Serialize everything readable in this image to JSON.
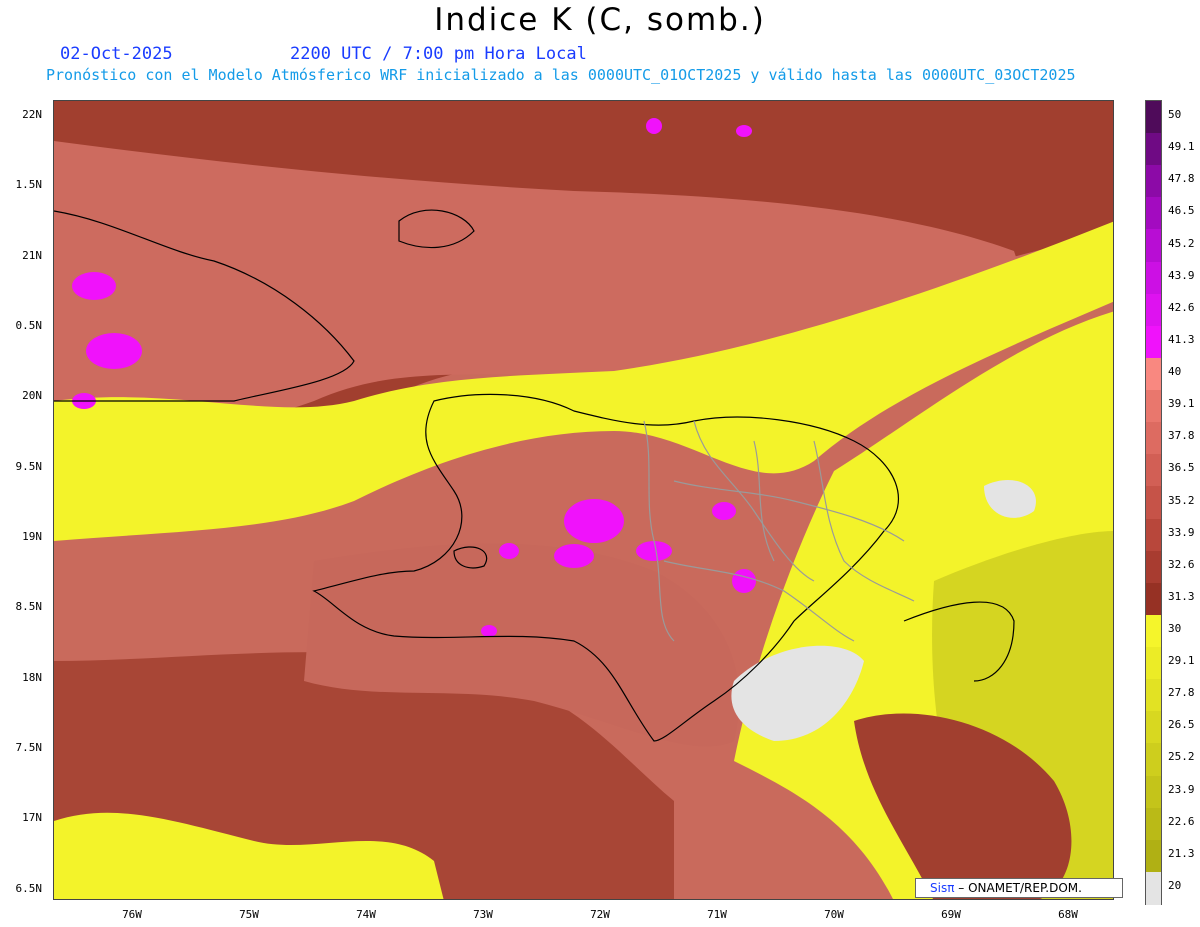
{
  "header": {
    "title": "Indice K (C, somb.)",
    "date": "02-Oct-2025",
    "time": "2200 UTC / 7:00 pm Hora Local",
    "subtitle": "Pronóstico con el Modelo Atmósferico WRF inicializado a las 0000UTC_01OCT2025 y válido hasta las  0000UTC_03OCT2025"
  },
  "axes": {
    "lat_labels": [
      "22N",
      "1.5N",
      "21N",
      "0.5N",
      "20N",
      "9.5N",
      "19N",
      "8.5N",
      "18N",
      "7.5N",
      "17N",
      "6.5N"
    ],
    "lon_labels": [
      "76W",
      "75W",
      "74W",
      "73W",
      "72W",
      "71W",
      "70W",
      "69W",
      "68W"
    ]
  },
  "colorbar": {
    "labels": [
      "50",
      "49.1",
      "47.8",
      "46.5",
      "45.2",
      "43.9",
      "42.6",
      "41.3",
      "40",
      "39.1",
      "37.8",
      "36.5",
      "35.2",
      "33.9",
      "32.6",
      "31.3",
      "30",
      "29.1",
      "27.8",
      "26.5",
      "25.2",
      "23.9",
      "22.6",
      "21.3",
      "20"
    ],
    "colors": [
      "#4f0b5a",
      "#6f0a84",
      "#8c0aa7",
      "#a30bc0",
      "#b80dd4",
      "#cc10e4",
      "#de12f0",
      "#f012fb",
      "#f98880",
      "#e9776d",
      "#dd6b61",
      "#d25f55",
      "#c65348",
      "#b8473b",
      "#a83c30",
      "#963124",
      "#f5f52b",
      "#ecec26",
      "#e2e223",
      "#d8d820",
      "#cece1d",
      "#c4c41a",
      "#baba17",
      "#b0b014",
      "#e4e4e4"
    ]
  },
  "credit": {
    "logo": "Sisπ",
    "text": "– ONAMET/REP.DOM."
  }
}
